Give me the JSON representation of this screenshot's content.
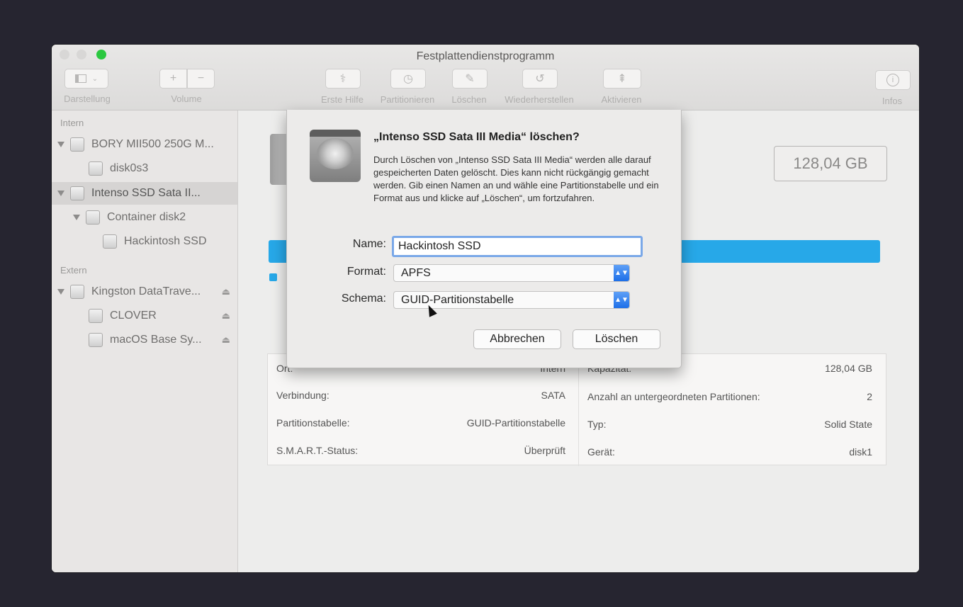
{
  "window": {
    "title": "Festplattendienstprogramm",
    "accent_color": "#27a8e8"
  },
  "toolbar": {
    "view_label": "Darstellung",
    "volume_label": "Volume",
    "volume_add": "+",
    "volume_remove": "−",
    "firstaid_label": "Erste Hilfe",
    "partition_label": "Partitionieren",
    "erase_label": "Löschen",
    "restore_label": "Wiederherstellen",
    "mount_label": "Aktivieren",
    "info_label": "Infos"
  },
  "sidebar": {
    "section_internal": "Intern",
    "section_external": "Extern",
    "items": [
      {
        "label": "BORY MII500 250G M..."
      },
      {
        "label": "disk0s3"
      },
      {
        "label": "Intenso SSD Sata II..."
      },
      {
        "label": "Container disk2"
      },
      {
        "label": "Hackintosh SSD"
      },
      {
        "label": "Kingston DataTrave..."
      },
      {
        "label": "CLOVER"
      },
      {
        "label": "macOS Base Sy..."
      }
    ]
  },
  "main": {
    "capacity": "128,04 GB",
    "info_left": [
      {
        "key": "Ort:",
        "value": "Intern"
      },
      {
        "key": "Verbindung:",
        "value": "SATA"
      },
      {
        "key": "Partitionstabelle:",
        "value": "GUID-Partitionstabelle"
      },
      {
        "key": "S.M.A.R.T.-Status:",
        "value": "Überprüft"
      }
    ],
    "info_right": [
      {
        "key": "Kapazität:",
        "value": "128,04 GB"
      },
      {
        "key": "Anzahl an untergeordneten Partitionen:",
        "value": "2"
      },
      {
        "key": "Typ:",
        "value": "Solid State"
      },
      {
        "key": "Gerät:",
        "value": "disk1"
      }
    ]
  },
  "dialog": {
    "title": "„Intenso SSD Sata III Media“ löschen?",
    "message": "Durch Löschen von „Intenso SSD Sata III Media“ werden alle darauf gespeicherten Daten gelöscht. Dies kann nicht rückgängig gemacht werden. Gib einen Namen an und wähle eine Partitionstabelle und ein Format aus und klicke auf „Löschen“, um fortzufahren.",
    "name_label": "Name:",
    "name_value": "Hackintosh SSD",
    "format_label": "Format:",
    "format_value": "APFS",
    "scheme_label": "Schema:",
    "scheme_value": "GUID-Partitionstabelle",
    "cancel_label": "Abbrechen",
    "erase_label": "Löschen"
  }
}
